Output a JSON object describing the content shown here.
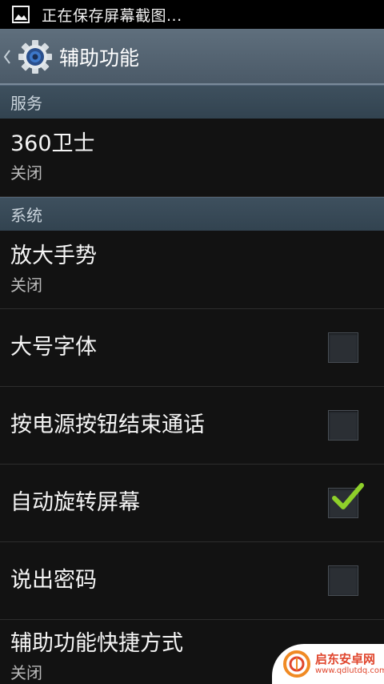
{
  "status_bar": {
    "notification_text": "正在保存屏幕截图...",
    "icon": "image-icon"
  },
  "action_bar": {
    "title": "辅助功能",
    "icon": "settings-gear-icon",
    "back_icon": "chevron-left-icon"
  },
  "sections": {
    "services": {
      "header": "服务",
      "items": [
        {
          "title": "360卫士",
          "summary": "关闭"
        }
      ]
    },
    "system": {
      "header": "系统",
      "items": [
        {
          "title": "放大手势",
          "summary": "关闭"
        },
        {
          "title": "大号字体",
          "checked": false
        },
        {
          "title": "按电源按钮结束通话",
          "checked": false
        },
        {
          "title": "自动旋转屏幕",
          "checked": true
        },
        {
          "title": "说出密码",
          "checked": false
        },
        {
          "title": "辅助功能快捷方式",
          "summary": "关闭"
        }
      ]
    }
  },
  "watermark": {
    "title": "启东安卓网",
    "url": "www.qdlutdq.com"
  },
  "colors": {
    "checkmark": "#8ed02a",
    "action_bar": "#566674",
    "section_header": "#3a4b58",
    "background": "#121212",
    "watermark_text": "#e0462d"
  }
}
